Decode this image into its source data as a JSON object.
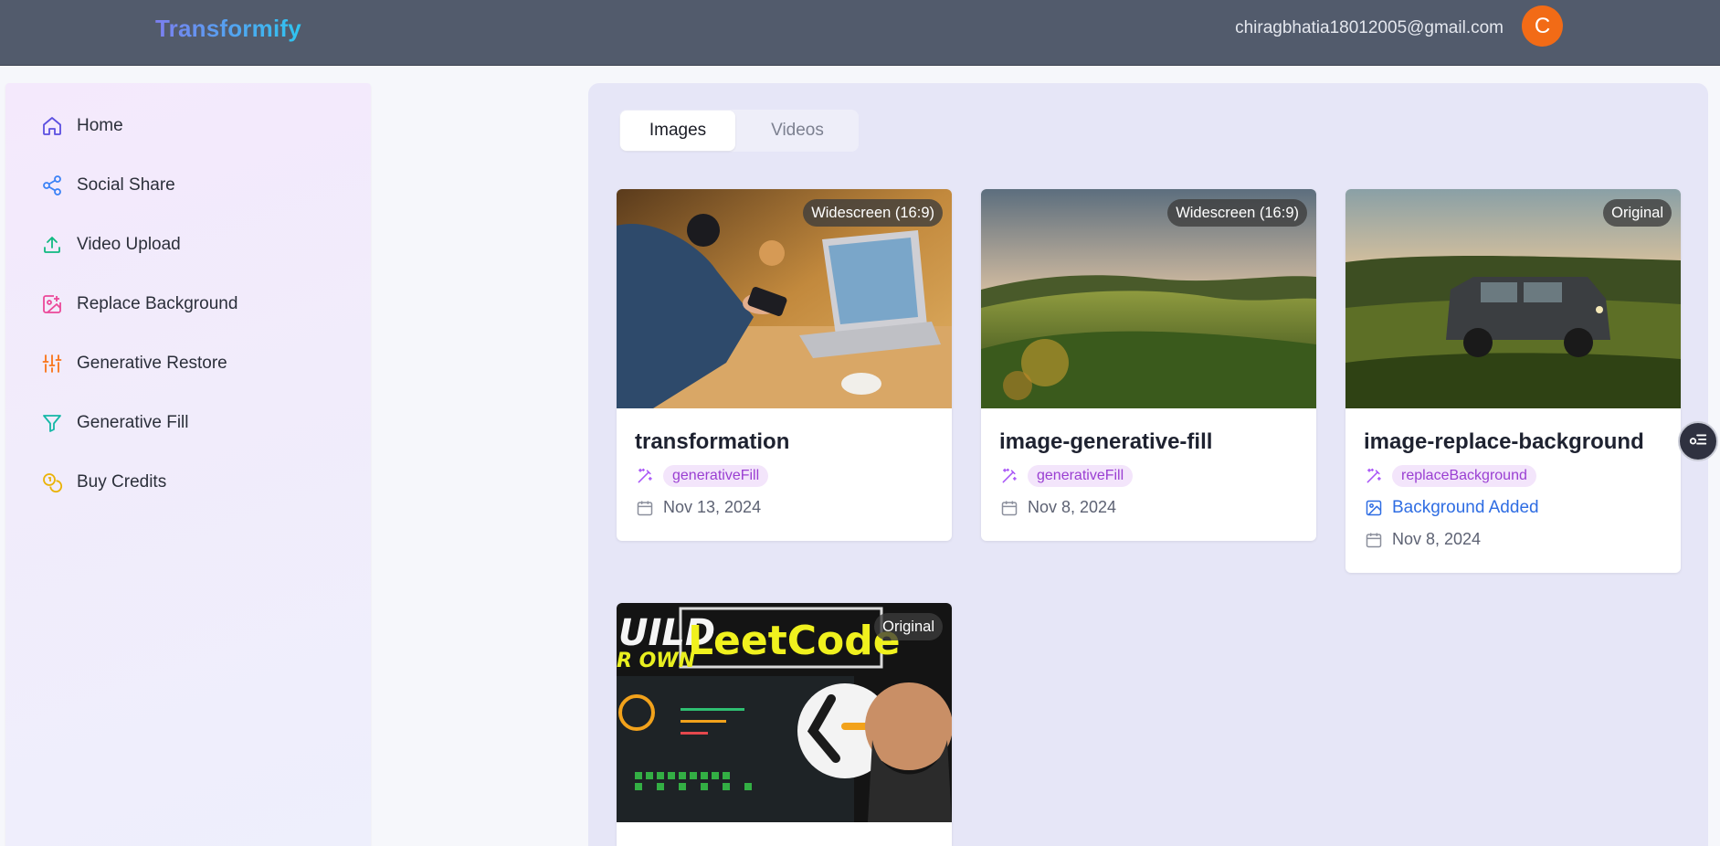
{
  "header": {
    "brand": "Transformify",
    "email": "chiragbhatia18012005@gmail.com",
    "avatar_initial": "C",
    "avatar_color": "#f26b16"
  },
  "sidebar": {
    "items": [
      {
        "label": "Home",
        "icon": "home-icon",
        "color": "#5b4fe0"
      },
      {
        "label": "Social Share",
        "icon": "share-icon",
        "color": "#3b82f6"
      },
      {
        "label": "Video Upload",
        "icon": "upload-icon",
        "color": "#10b981"
      },
      {
        "label": "Replace Background",
        "icon": "image-plus-icon",
        "color": "#ec4899"
      },
      {
        "label": "Generative Restore",
        "icon": "sliders-icon",
        "color": "#f97316"
      },
      {
        "label": "Generative Fill",
        "icon": "filter-icon",
        "color": "#14b8a6"
      },
      {
        "label": "Buy Credits",
        "icon": "coins-icon",
        "color": "#eab308"
      }
    ]
  },
  "tabs": [
    {
      "label": "Images",
      "active": true
    },
    {
      "label": "Videos",
      "active": false
    }
  ],
  "cards": [
    {
      "title": "transformation",
      "badge": "Widescreen (16:9)",
      "tag": "generativeFill",
      "date": "Nov 13, 2024"
    },
    {
      "title": "image-generative-fill",
      "badge": "Widescreen (16:9)",
      "tag": "generativeFill",
      "date": "Nov 8, 2024"
    },
    {
      "title": "image-replace-background",
      "badge": "Original",
      "tag": "replaceBackground",
      "extra": "Background Added",
      "date": "Nov 8, 2024"
    },
    {
      "title": "",
      "badge": "Original",
      "thumb_text_1": "UILD",
      "thumb_text_2": "R OWN",
      "thumb_text_3": "LeetCode"
    }
  ],
  "colors": {
    "topbar": "#525b6c",
    "panel": "#e6e6f7",
    "chip_bg": "#f3e5fb",
    "chip_text": "#9a3fd2",
    "link": "#2f6de3"
  }
}
